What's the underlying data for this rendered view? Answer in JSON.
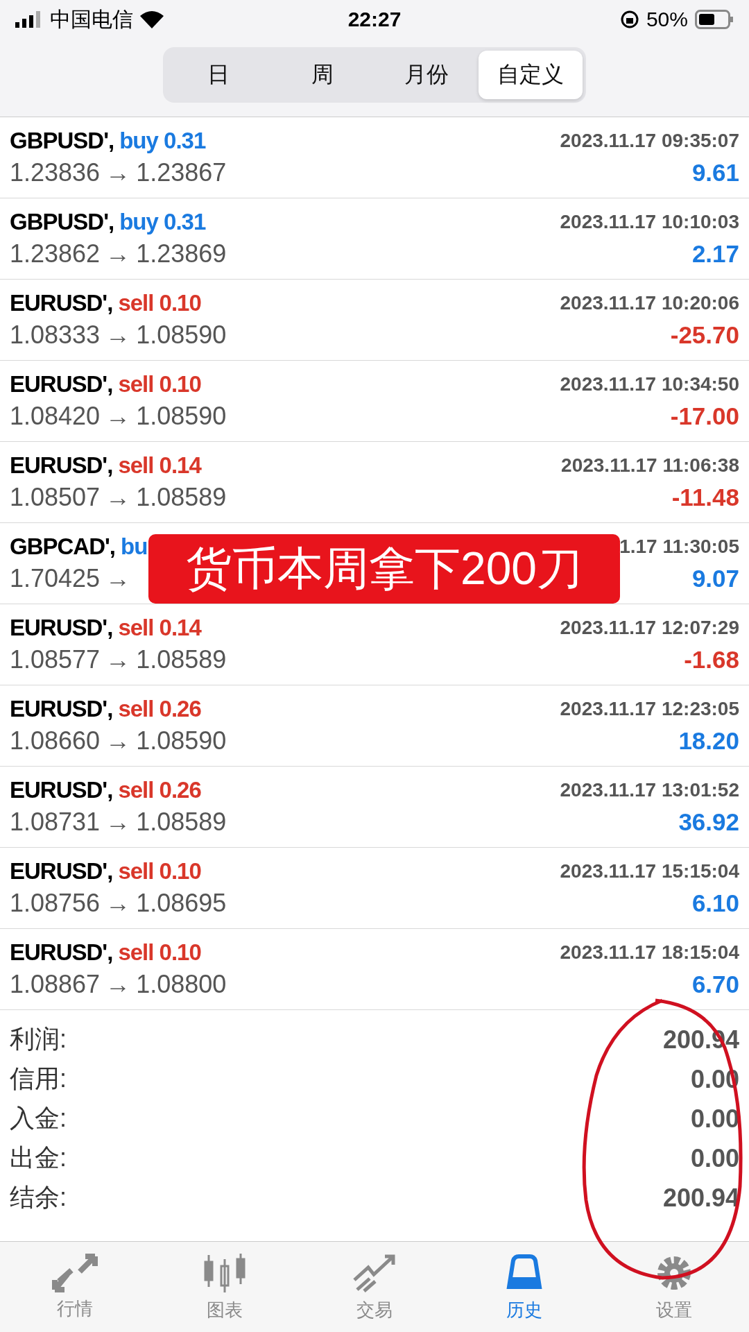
{
  "status_bar": {
    "carrier": "中国电信",
    "time": "22:27",
    "battery": "50%"
  },
  "period_tabs": [
    {
      "label": "日",
      "selected": false
    },
    {
      "label": "周",
      "selected": false
    },
    {
      "label": "月份",
      "selected": false
    },
    {
      "label": "自定义",
      "selected": true
    }
  ],
  "deals": [
    {
      "symbol": "GBPUSD',",
      "kind": "buy",
      "side": "buy",
      "lot": "0.31",
      "time": "2023.11.17 09:35:07",
      "open": "1.23836",
      "arrow": "→",
      "close": "1.23867",
      "profit": "9.61"
    },
    {
      "symbol": "GBPUSD',",
      "kind": "buy",
      "side": "buy",
      "lot": "0.31",
      "time": "2023.11.17 10:10:03",
      "open": "1.23862",
      "arrow": "→",
      "close": "1.23869",
      "profit": "2.17"
    },
    {
      "symbol": "EURUSD',",
      "kind": "sell",
      "side": "sell",
      "lot": "0.10",
      "time": "2023.11.17 10:20:06",
      "open": "1.08333",
      "arrow": "→",
      "close": "1.08590",
      "profit": "-25.70"
    },
    {
      "symbol": "EURUSD',",
      "kind": "sell",
      "side": "sell",
      "lot": "0.10",
      "time": "2023.11.17 10:34:50",
      "open": "1.08420",
      "arrow": "→",
      "close": "1.08590",
      "profit": "-17.00"
    },
    {
      "symbol": "EURUSD',",
      "kind": "sell",
      "side": "sell",
      "lot": "0.14",
      "time": "2023.11.17 11:06:38",
      "open": "1.08507",
      "arrow": "→",
      "close": "1.08589",
      "profit": "-11.48"
    },
    {
      "symbol": "GBPCAD',",
      "kind": "buy",
      "side": "bu",
      "time": "1.17 11:30:05",
      "open": "1.70425",
      "arrow": "→",
      "profit": "9.07"
    },
    {
      "symbol": "EURUSD',",
      "kind": "sell",
      "side": "sell",
      "lot": "0.14",
      "time": "2023.11.17 12:07:29",
      "open": "1.08577",
      "arrow": "→",
      "close": "1.08589",
      "profit": "-1.68"
    },
    {
      "symbol": "EURUSD',",
      "kind": "sell",
      "side": "sell",
      "lot": "0.26",
      "time": "2023.11.17 12:23:05",
      "open": "1.08660",
      "arrow": "→",
      "close": "1.08590",
      "profit": "18.20"
    },
    {
      "symbol": "EURUSD',",
      "kind": "sell",
      "side": "sell",
      "lot": "0.26",
      "time": "2023.11.17 13:01:52",
      "open": "1.08731",
      "arrow": "→",
      "close": "1.08589",
      "profit": "36.92"
    },
    {
      "symbol": "EURUSD',",
      "kind": "sell",
      "side": "sell",
      "lot": "0.10",
      "time": "2023.11.17 15:15:04",
      "open": "1.08756",
      "arrow": "→",
      "close": "1.08695",
      "profit": "6.10"
    },
    {
      "symbol": "EURUSD',",
      "kind": "sell",
      "side": "sell",
      "lot": "0.10",
      "time": "2023.11.17 18:15:04",
      "open": "1.08867",
      "arrow": "→",
      "close": "1.08800",
      "profit": "6.70"
    }
  ],
  "summary": [
    {
      "label": "利润:",
      "value": "200.94"
    },
    {
      "label": "信用:",
      "value": "0.00"
    },
    {
      "label": "入金:",
      "value": "0.00"
    },
    {
      "label": "出金:",
      "value": "0.00"
    },
    {
      "label": "结余:",
      "value": "200.94"
    }
  ],
  "overlay_banner": "货币本周拿下200刀",
  "circle_annotation": true,
  "bottom_tabs": [
    {
      "label": "行情",
      "kind": "quotes",
      "selected": false
    },
    {
      "label": "图表",
      "kind": "chart",
      "selected": false
    },
    {
      "label": "交易",
      "kind": "trade",
      "selected": false
    },
    {
      "label": "历史",
      "kind": "history",
      "selected": true
    },
    {
      "label": "设置",
      "kind": "settings",
      "selected": false
    }
  ]
}
